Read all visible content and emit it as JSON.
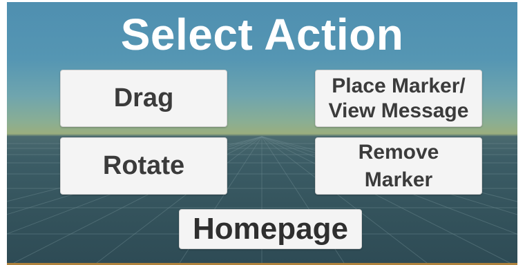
{
  "title": "Select Action",
  "buttons": {
    "drag": "Drag",
    "place_line1": "Place Marker/",
    "place_line2": "View Message",
    "rotate": "Rotate",
    "remove_line1": "Remove",
    "remove_line2": "Marker",
    "homepage": "Homepage"
  },
  "colors": {
    "sky": "#5596b3",
    "ground": "#34535c",
    "button_bg": "#f4f4f4",
    "button_text": "#3b3b3b",
    "title_text": "#ffffff"
  }
}
